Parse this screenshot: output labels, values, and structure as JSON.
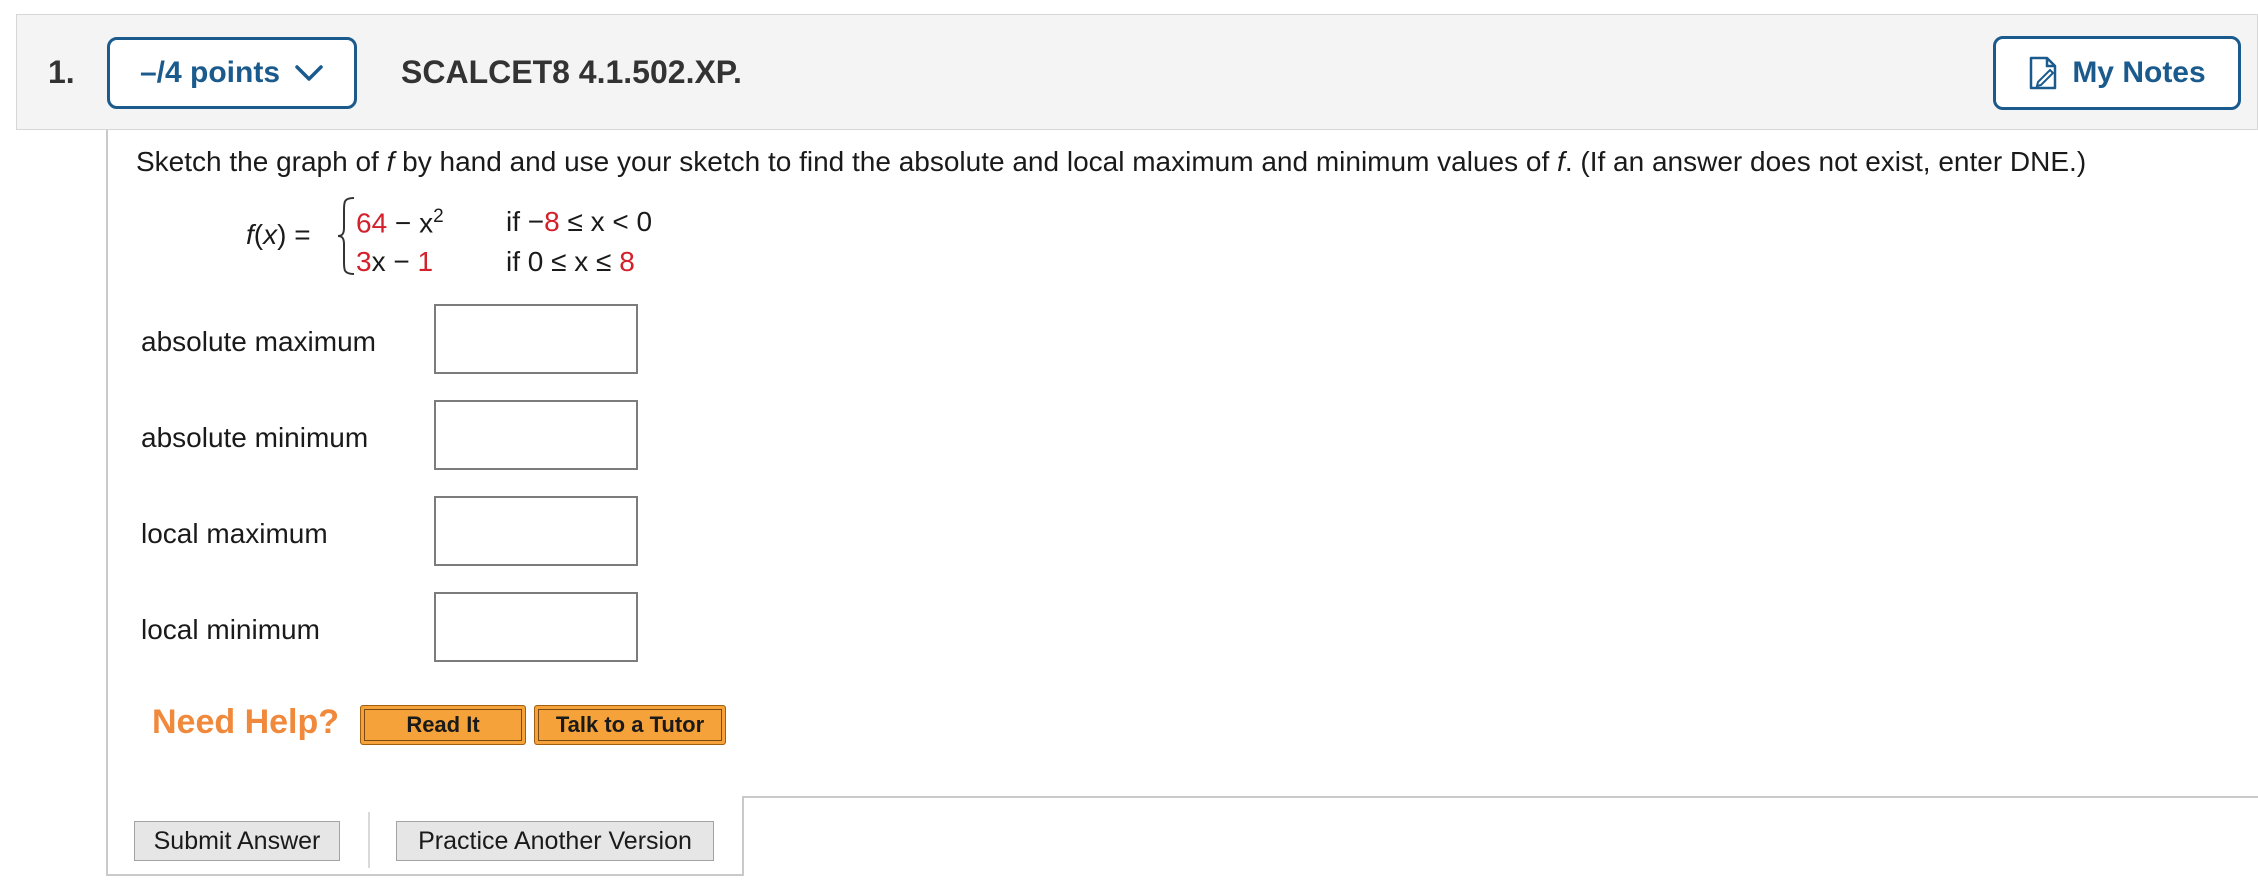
{
  "header": {
    "question_number": "1.",
    "points_label": "–/4 points",
    "question_code": "SCALCET8 4.1.502.XP.",
    "notes_label": "My Notes"
  },
  "question": {
    "prefix": "Sketch the graph of ",
    "var1": "f",
    "middle": " by hand and use your sketch to find the absolute and local maximum and minimum values of ",
    "var2": "f",
    "suffix": ". (If an answer does not exist, enter DNE.)"
  },
  "function": {
    "name": "f",
    "arg": "x",
    "case1": {
      "expr_num": "64",
      "expr_rest": " − x",
      "exponent": "2",
      "cond_prefix": "if −",
      "cond_num": "8",
      "cond_suffix": " ≤ x < 0"
    },
    "case2": {
      "expr_coef": "3",
      "expr_mid": "x − ",
      "expr_const": "1",
      "cond_prefix": "if 0 ≤ x ≤ ",
      "cond_num": "8"
    }
  },
  "answers": [
    {
      "label": "absolute maximum",
      "value": ""
    },
    {
      "label": "absolute minimum",
      "value": ""
    },
    {
      "label": "local maximum",
      "value": ""
    },
    {
      "label": "local minimum",
      "value": ""
    }
  ],
  "help": {
    "label": "Need Help?",
    "read_it": "Read It",
    "tutor": "Talk to a Tutor"
  },
  "actions": {
    "submit": "Submit Answer",
    "practice": "Practice Another Version"
  },
  "colors": {
    "accent_blue": "#1a5a8c",
    "highlight_red": "#d3202a",
    "help_orange": "#f0893b",
    "button_orange": "#f5a23a"
  },
  "icons": {
    "dropdown": "chevron-down-icon",
    "notes": "note-edit-icon"
  }
}
